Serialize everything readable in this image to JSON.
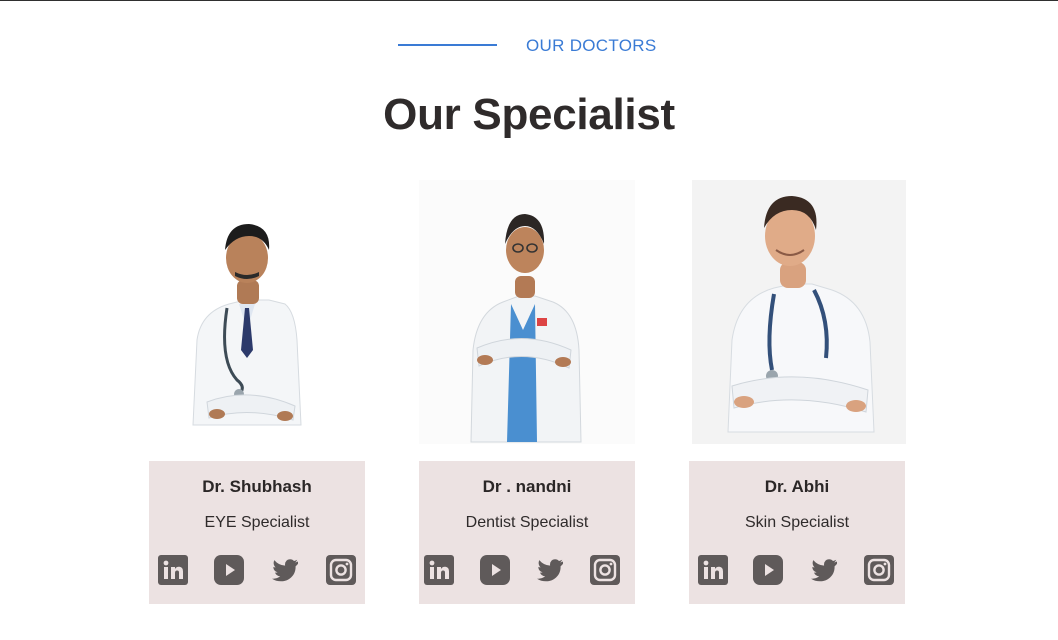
{
  "section": {
    "eyebrow": "OUR DOCTORS",
    "title": "Our Specialist"
  },
  "colors": {
    "accent": "#3a7bd5",
    "card_bg": "#ece2e2",
    "icon": "#5f5a5a",
    "title": "#2f2b2b"
  },
  "doctors": [
    {
      "name": "Dr. Shubhash",
      "specialty": "EYE Specialist",
      "social_icons": [
        "linkedin-icon",
        "youtube-icon",
        "twitter-icon",
        "instagram-icon"
      ]
    },
    {
      "name": "Dr . nandni",
      "specialty": "Dentist Specialist",
      "social_icons": [
        "linkedin-icon",
        "youtube-icon",
        "twitter-icon",
        "instagram-icon"
      ]
    },
    {
      "name": "Dr. Abhi",
      "specialty": "Skin Specialist",
      "social_icons": [
        "linkedin-icon",
        "youtube-icon",
        "twitter-icon",
        "instagram-icon"
      ]
    }
  ]
}
